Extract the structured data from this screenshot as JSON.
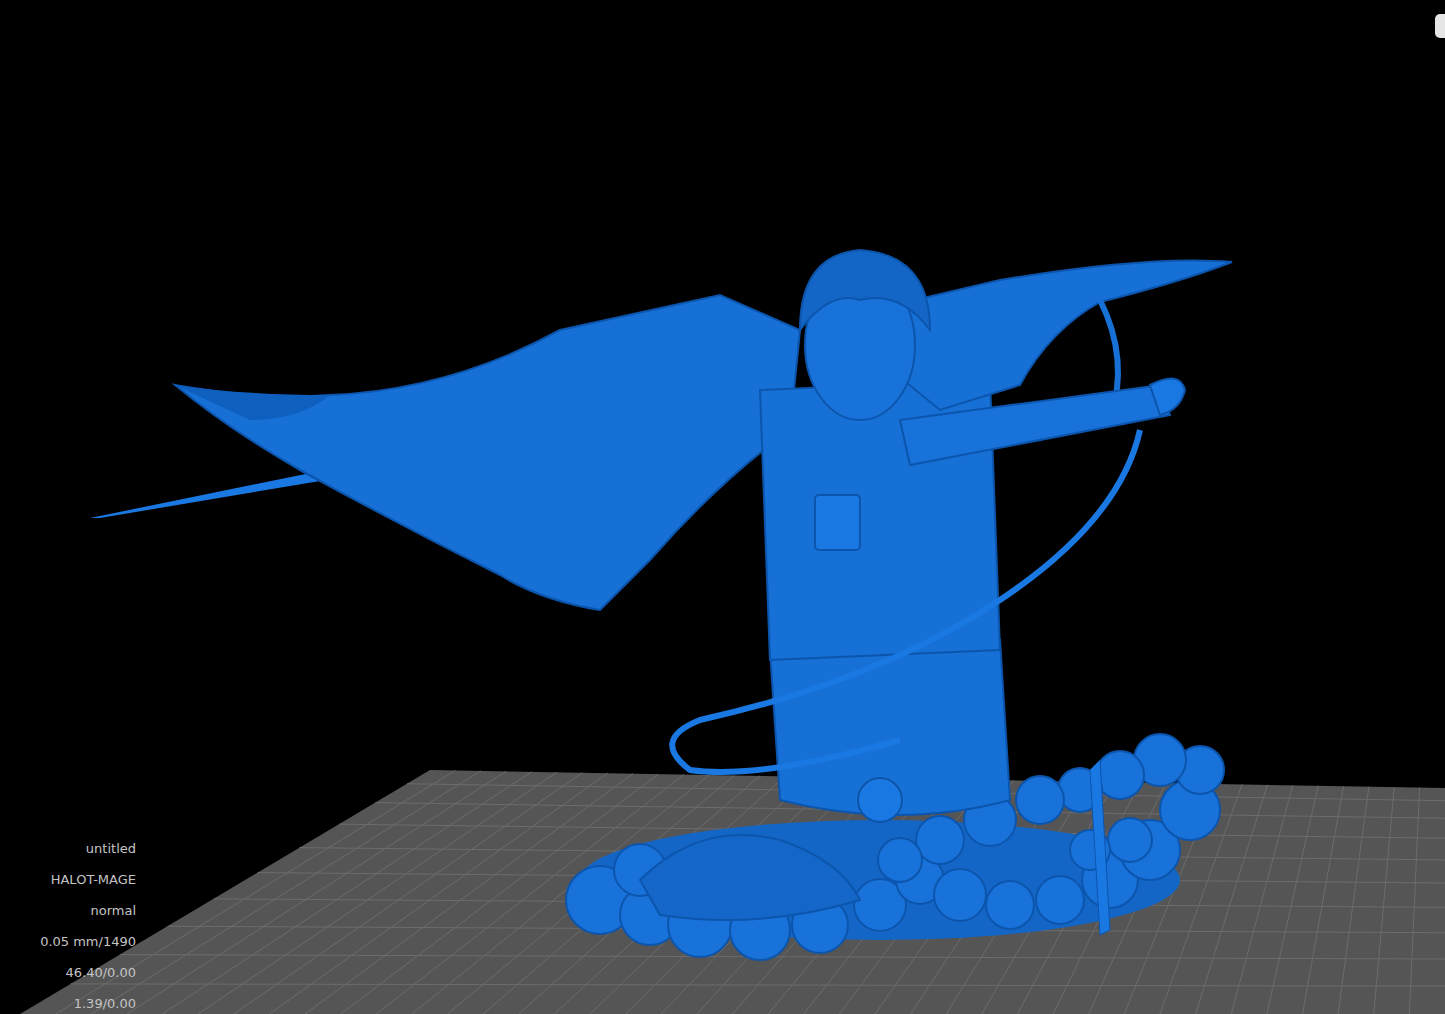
{
  "viewport": {
    "info_lines": [
      "untitled",
      "HALOT-MAGE",
      "normal",
      "0.05 mm/1490",
      "46.40/0.00",
      "1.39/0.00"
    ]
  }
}
